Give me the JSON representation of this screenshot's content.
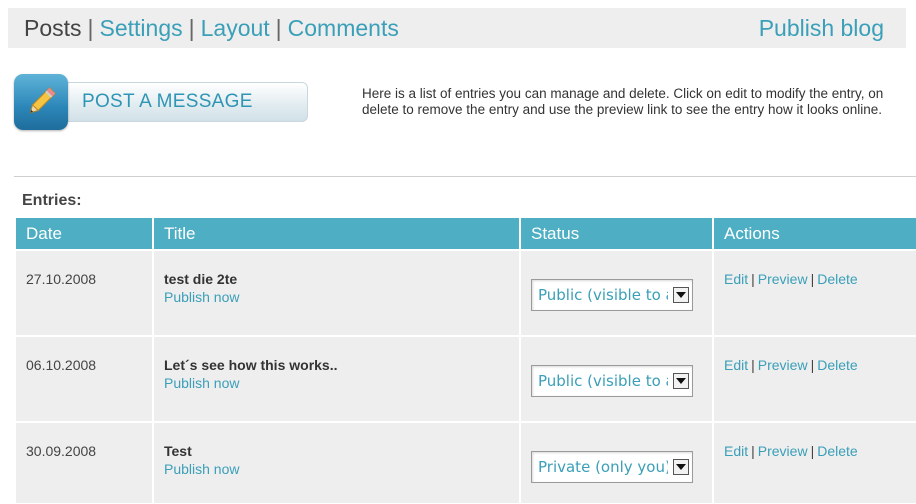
{
  "nav": {
    "current": "Posts",
    "items": [
      "Settings",
      "Layout",
      "Comments"
    ],
    "separator": "|",
    "publish": "Publish blog"
  },
  "post_button": {
    "label": "POST A MESSAGE",
    "icon": "pencil-icon"
  },
  "intro": "Here is a list of entries you can manage and delete. Click on edit to modify the entry, on delete to remove the entry and use the preview link to see the entry how it looks online.",
  "entries": {
    "label": "Entries:",
    "columns": [
      "Date",
      "Title",
      "Status",
      "Actions"
    ],
    "rows": [
      {
        "date": "27.10.2008",
        "title": "test die 2te",
        "publish": "Publish now",
        "status": "Public (visible to all)"
      },
      {
        "date": "06.10.2008",
        "title": "Let´s see how this works..",
        "publish": "Publish now",
        "status": "Public (visible to all)"
      },
      {
        "date": "30.09.2008",
        "title": "Test",
        "publish": "Publish now",
        "status": "Private (only you)"
      }
    ],
    "actions": {
      "edit": "Edit",
      "preview": "Preview",
      "delete": "Delete",
      "separator": "|"
    }
  },
  "colors": {
    "accent": "#3a9fb8",
    "header_bg": "#4eaec3",
    "row_bg": "#eeeeee",
    "nav_bg": "#eeeeee"
  }
}
